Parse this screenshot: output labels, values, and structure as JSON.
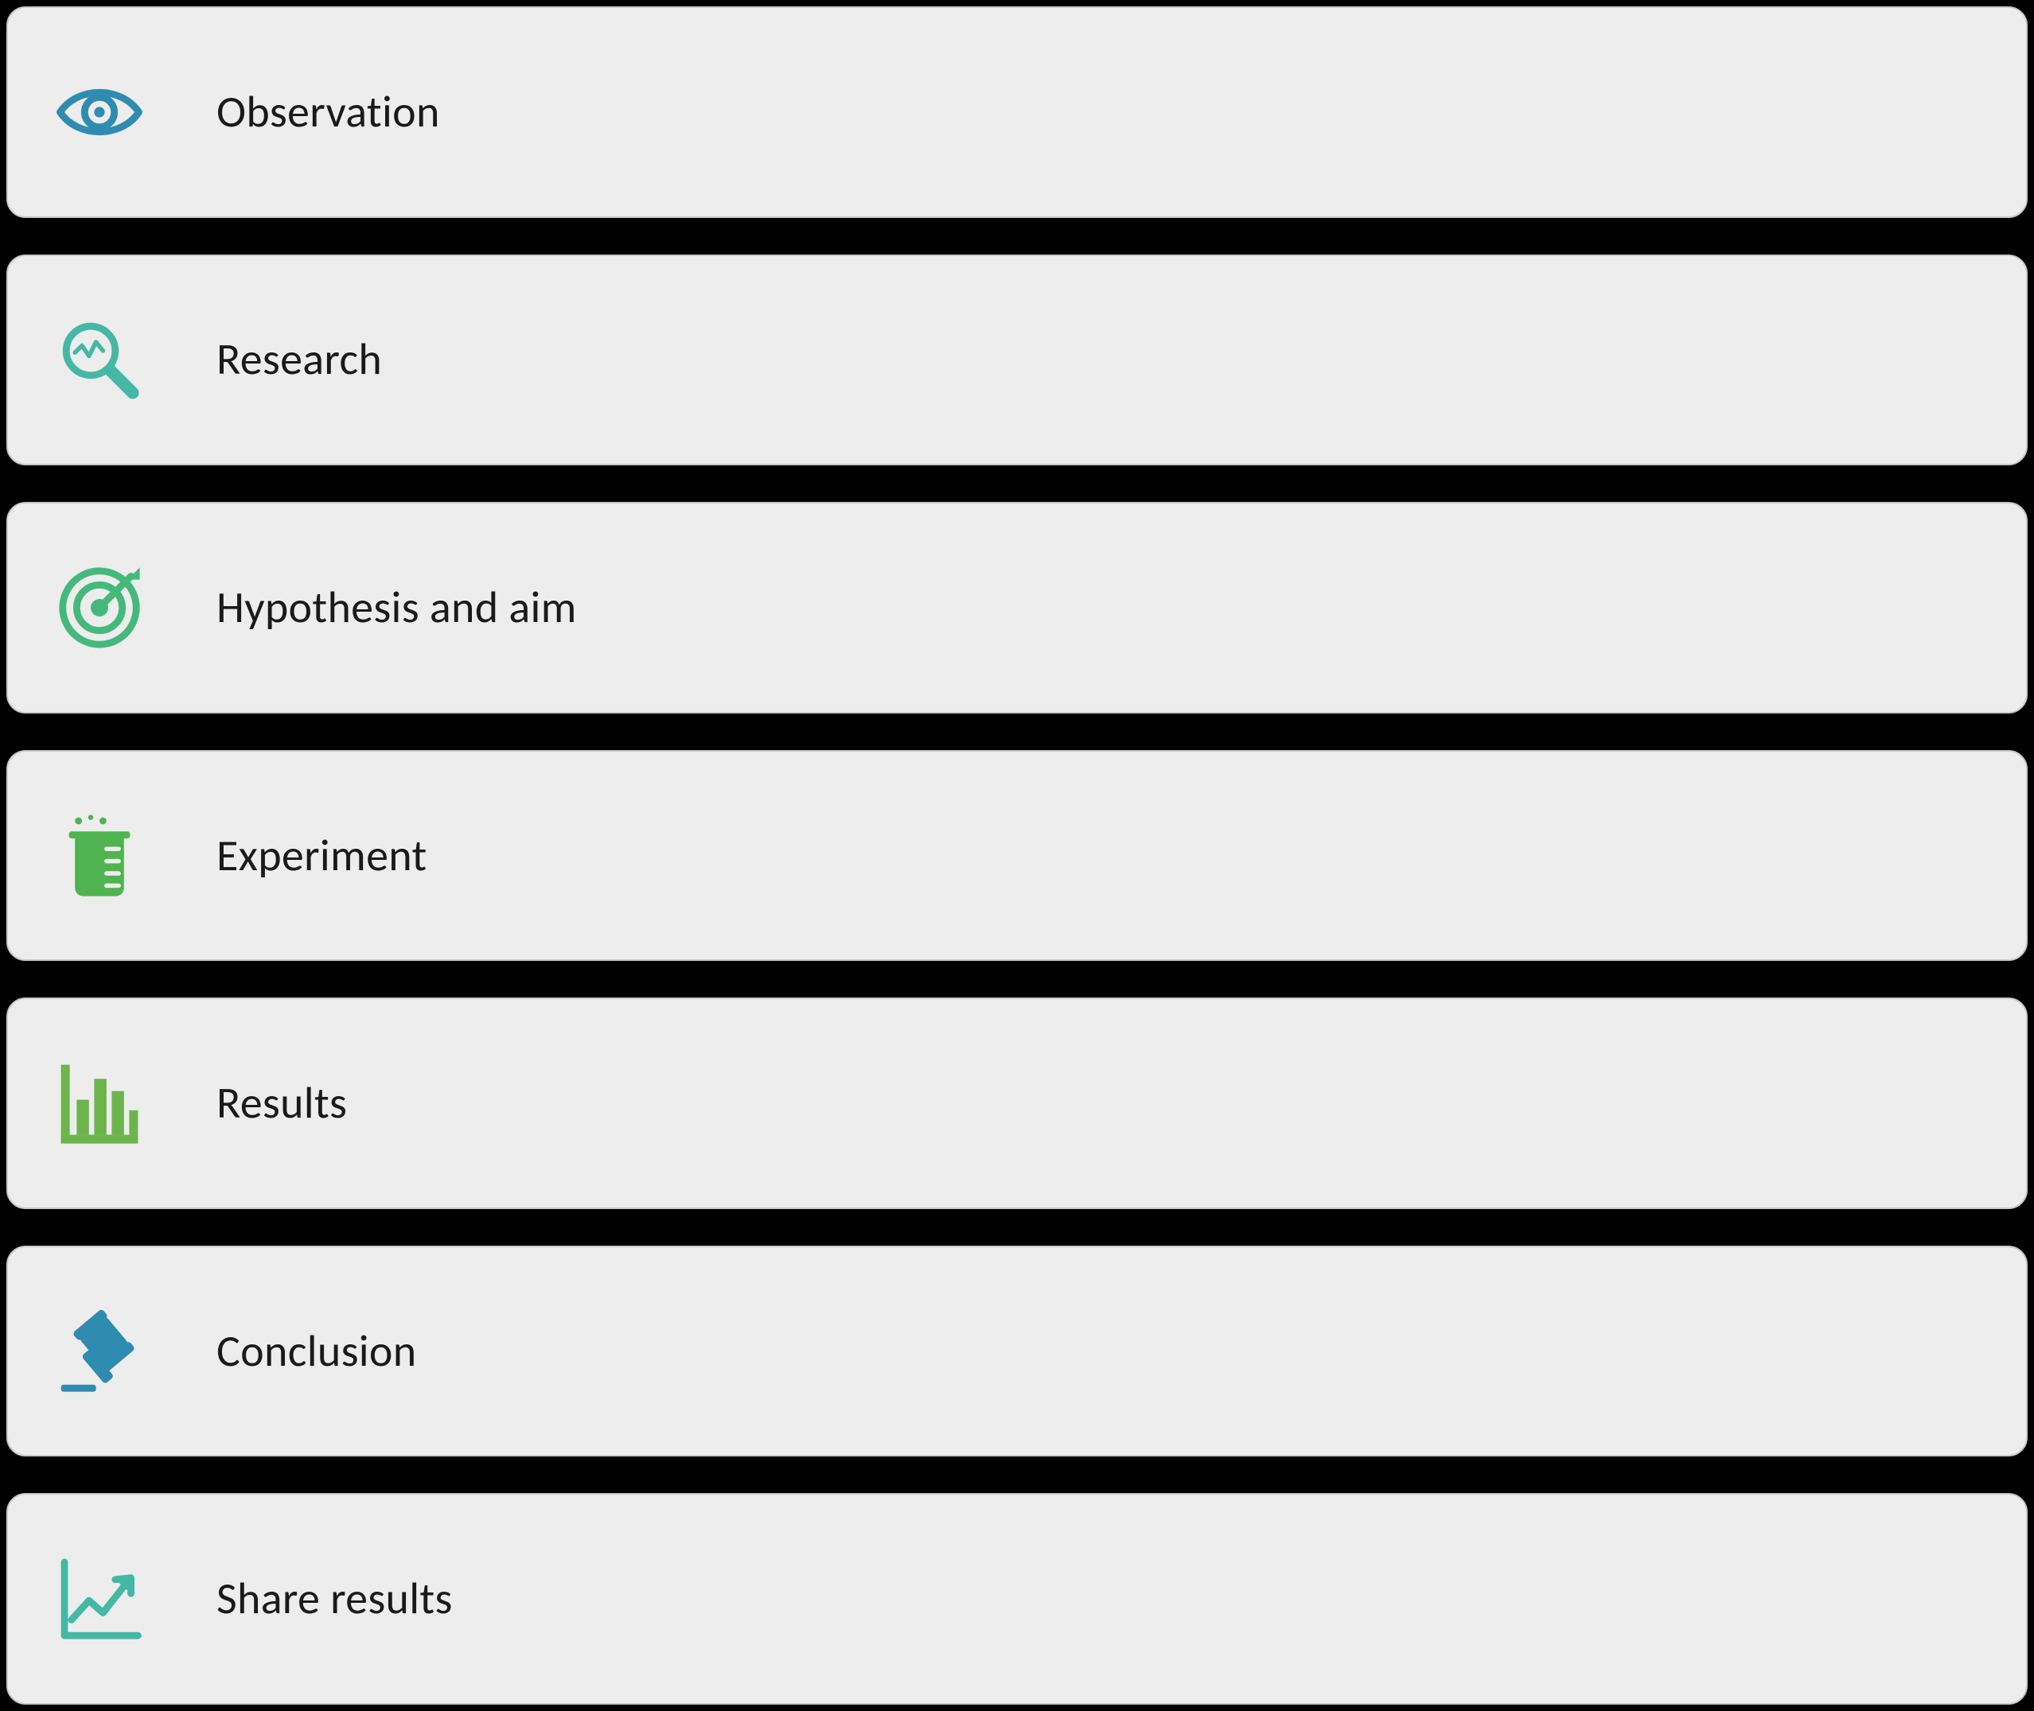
{
  "steps": [
    {
      "icon": "eye-icon",
      "label": "Observation",
      "color": "#2f8cb0"
    },
    {
      "icon": "research-icon",
      "label": "Research",
      "color": "#45b8a5"
    },
    {
      "icon": "target-icon",
      "label": "Hypothesis and aim",
      "color": "#45b97c"
    },
    {
      "icon": "beaker-icon",
      "label": "Experiment",
      "color": "#4fb44f"
    },
    {
      "icon": "barchart-icon",
      "label": "Results",
      "color": "#6cb44c"
    },
    {
      "icon": "gavel-icon",
      "label": "Conclusion",
      "color": "#2f8cb0"
    },
    {
      "icon": "growth-icon",
      "label": "Share results",
      "color": "#45b8a5"
    }
  ],
  "colors": {
    "row_bg": "#ededed",
    "row_border": "#c9c9c9",
    "stage_bg": "#000000",
    "text": "#1a1a1a"
  }
}
